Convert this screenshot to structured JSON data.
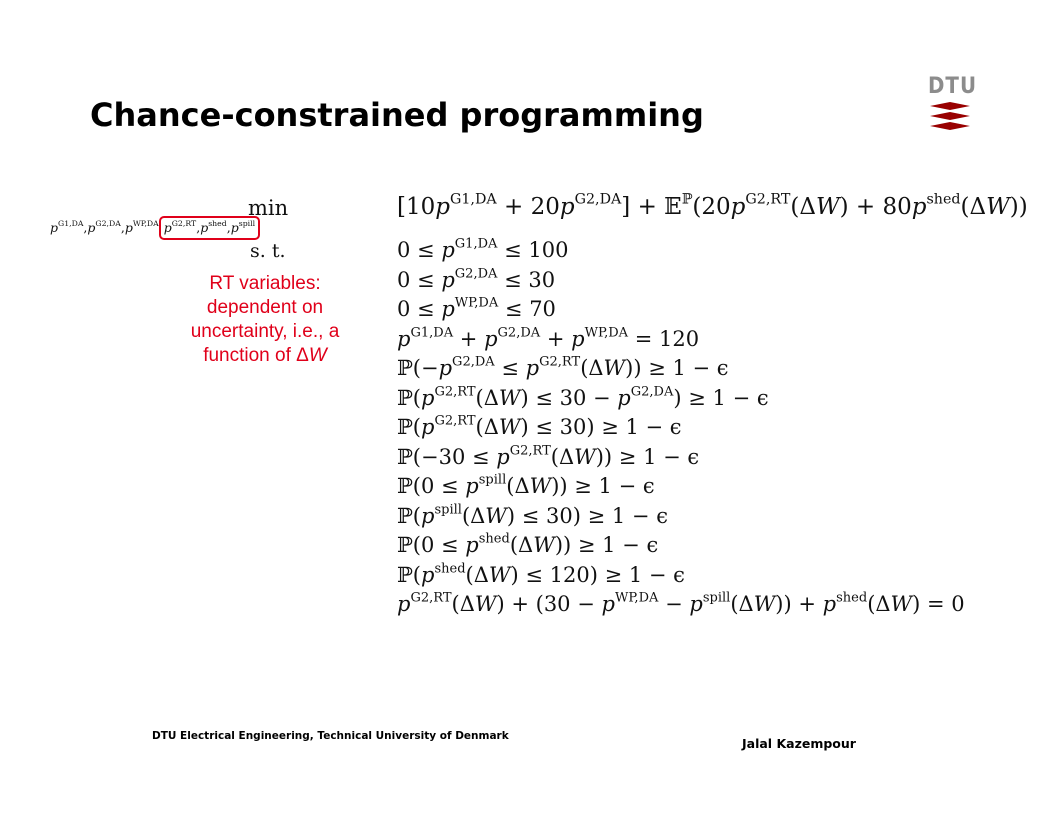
{
  "slide": {
    "title": "Chance-constrained programming",
    "logo_text": "DTU",
    "accent_color": "#e0001a",
    "logo_color": "#990000"
  },
  "math": {
    "min_label": "min",
    "subscript_vars": [
      "p",
      "G1,DA",
      ",",
      "p",
      "G2,DA",
      ",",
      "p",
      "WP,DA"
    ],
    "rt_vars": [
      "p",
      "G2,RT",
      ",",
      "p",
      "shed",
      ",",
      "p",
      "spill"
    ],
    "st_label": "s. t.",
    "annotation_lines": [
      "RT variables:",
      "dependent on",
      "uncertainty, i.e., a",
      "function of ΔW"
    ],
    "objective": "[10p^{G1,DA} + 20p^{G2,DA}] + 𝔼^{ℙ}(20p^{G2,RT}(ΔW) + 80p^{shed}(ΔW))",
    "constraints": [
      "0 ≤ p^{G1,DA} ≤ 100",
      "0 ≤ p^{G2,DA} ≤ 30",
      "0 ≤ p^{WP,DA} ≤ 70",
      "p^{G1,DA} + p^{G2,DA} + p^{WP,DA} = 120",
      "ℙ(−p^{G2,DA} ≤ p^{G2,RT}(ΔW)) ≥ 1 − ϵ",
      "ℙ(p^{G2,RT}(ΔW) ≤ 30 − p^{G2,DA}) ≥ 1 − ϵ",
      "ℙ(p^{G2,RT}(ΔW) ≤ 30) ≥ 1 − ϵ",
      "ℙ(−30 ≤ p^{G2,RT}(ΔW)) ≥ 1 − ϵ",
      "ℙ(0 ≤ p^{spill}(ΔW)) ≥ 1 − ϵ",
      "ℙ(p^{spill}(ΔW) ≤ 30) ≥ 1 − ϵ",
      "ℙ(0 ≤ p^{shed}(ΔW)) ≥ 1 − ϵ",
      "ℙ(p^{shed}(ΔW) ≤ 120) ≥ 1 − ϵ",
      "p^{G2,RT}(ΔW) + (30 − p^{WP,DA} − p^{spill}(ΔW)) + p^{shed}(ΔW) = 0"
    ]
  },
  "footer": {
    "left": "DTU Electrical Engineering, Technical University of Denmark",
    "right": "Jalal Kazempour"
  }
}
